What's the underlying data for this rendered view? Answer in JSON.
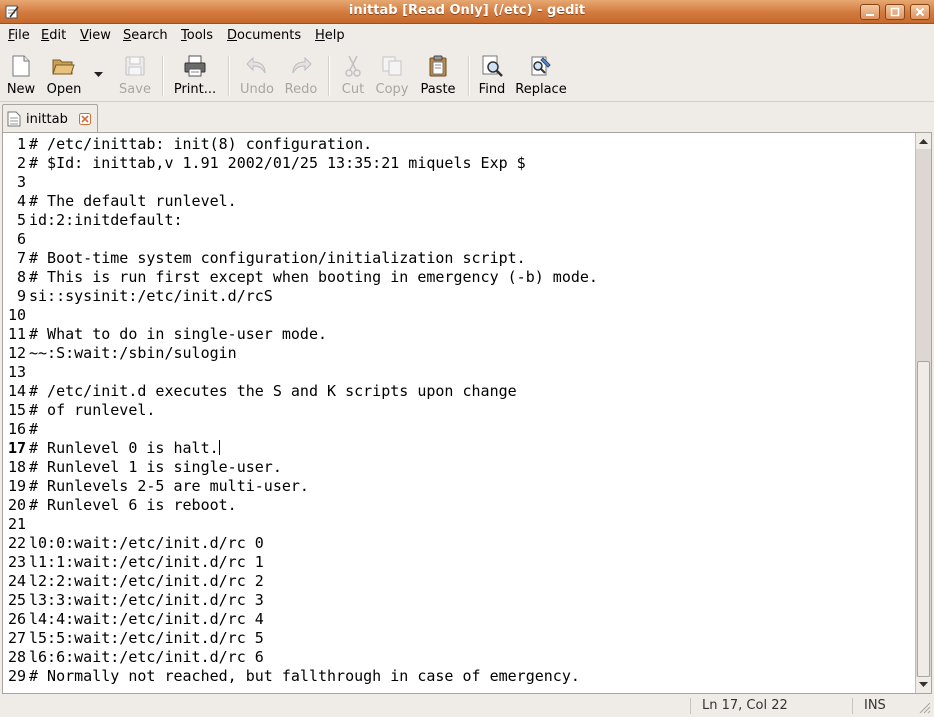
{
  "window": {
    "title": "inittab [Read Only] (/etc) - gedit"
  },
  "menu": [
    {
      "pre": "",
      "mn": "F",
      "post": "ile"
    },
    {
      "pre": "",
      "mn": "E",
      "post": "dit"
    },
    {
      "pre": "",
      "mn": "V",
      "post": "iew"
    },
    {
      "pre": "",
      "mn": "S",
      "post": "earch"
    },
    {
      "pre": "",
      "mn": "T",
      "post": "ools"
    },
    {
      "pre": "",
      "mn": "D",
      "post": "ocuments"
    },
    {
      "pre": "",
      "mn": "H",
      "post": "elp"
    }
  ],
  "toolbar": {
    "new": "New",
    "open": "Open",
    "save": "Save",
    "print": "Print...",
    "undo": "Undo",
    "redo": "Redo",
    "cut": "Cut",
    "copy": "Copy",
    "paste": "Paste",
    "find": "Find",
    "replace": "Replace"
  },
  "tab": {
    "label": "inittab"
  },
  "editor": {
    "current_line": 17,
    "lines": [
      "# /etc/inittab: init(8) configuration.",
      "# $Id: inittab,v 1.91 2002/01/25 13:35:21 miquels Exp $",
      "",
      "# The default runlevel.",
      "id:2:initdefault:",
      "",
      "# Boot-time system configuration/initialization script.",
      "# This is run first except when booting in emergency (-b) mode.",
      "si::sysinit:/etc/init.d/rcS",
      "",
      "# What to do in single-user mode.",
      "~~:S:wait:/sbin/sulogin",
      "",
      "# /etc/init.d executes the S and K scripts upon change",
      "# of runlevel.",
      "#",
      "# Runlevel 0 is halt.",
      "# Runlevel 1 is single-user.",
      "# Runlevels 2-5 are multi-user.",
      "# Runlevel 6 is reboot.",
      "",
      "l0:0:wait:/etc/init.d/rc 0",
      "l1:1:wait:/etc/init.d/rc 1",
      "l2:2:wait:/etc/init.d/rc 2",
      "l3:3:wait:/etc/init.d/rc 3",
      "l4:4:wait:/etc/init.d/rc 4",
      "l5:5:wait:/etc/init.d/rc 5",
      "l6:6:wait:/etc/init.d/rc 6",
      "# Normally not reached, but fallthrough in case of emergency."
    ]
  },
  "statusbar": {
    "position": "Ln 17, Col 22",
    "mode": "INS"
  },
  "colors": {
    "titlebar": "#d37a3e",
    "window_bg": "#efebe7",
    "editor_bg": "#ffffff"
  }
}
